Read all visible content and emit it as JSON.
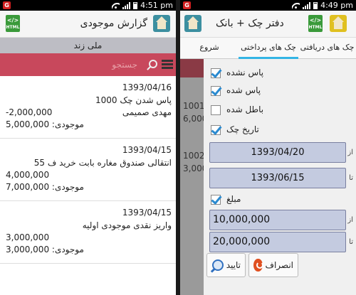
{
  "left": {
    "clock": "4:51 pm",
    "title": "گزارش موجودی",
    "html_icon_label": "HTML",
    "subtitle": "ملی زند",
    "search_placeholder": "جستجو",
    "items": [
      {
        "date": "1393/04/16",
        "desc": "پاس شدن چک  1000",
        "name": "مهدی صمیمی",
        "amount": "-2,000,000",
        "balance_label": "موجودی:",
        "balance": "5,000,000"
      },
      {
        "date": "1393/04/15",
        "desc": "انتقالی صندوق مغاره بابت خرید ف 55",
        "name": "",
        "amount": "4,000,000",
        "balance_label": "موجودی:",
        "balance": "7,000,000"
      },
      {
        "date": "1393/04/15",
        "desc": "واریز نقدی موجودی اولیه",
        "name": "",
        "amount": "3,000,000",
        "balance_label": "موجودی:",
        "balance": "3,000,000"
      }
    ]
  },
  "right": {
    "clock": "4:49 pm",
    "title": "دفتر چک + بانک",
    "html_icon_label": "HTML",
    "tabs": [
      "چک های دریافتی",
      "چک های پرداختی",
      "شروع"
    ],
    "background_values": [
      "1001",
      "6,000",
      "1002",
      "3,000"
    ],
    "dialog": {
      "checkboxes": [
        {
          "label": "پاس نشده",
          "checked": true
        },
        {
          "label": "پاس شده",
          "checked": true
        },
        {
          "label": "باطل شده",
          "checked": false
        },
        {
          "label": "تاریخ چک",
          "checked": true
        }
      ],
      "from_label": "از",
      "to_label": "تا",
      "date_from": "1393/04/20",
      "date_to": "1393/06/15",
      "amount_checkbox": {
        "label": "مبلغ",
        "checked": true
      },
      "amount_from": "10,000,000",
      "amount_to": "20,000,000",
      "confirm_label": "تایید",
      "cancel_label": "انصراف"
    }
  }
}
